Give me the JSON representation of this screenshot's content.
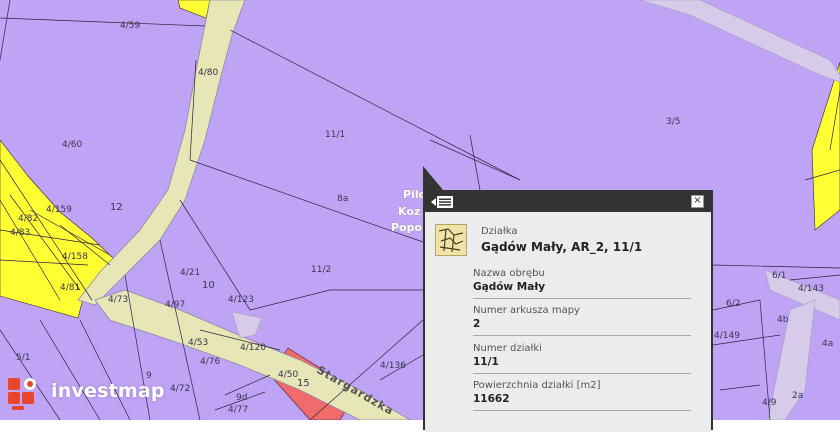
{
  "map": {
    "colors": {
      "background": "#bfa3f4",
      "road": "#e6e6b6",
      "yellow": "#ffff33",
      "red": "#f26b6b",
      "line": "#2e2440"
    },
    "parcel_labels": [
      "4/59",
      "4/80",
      "4/60",
      "11/1",
      "3/5",
      "8a",
      "12",
      "4/82",
      "4/159",
      "4/83",
      "4/158",
      "4/81",
      "4/21",
      "10",
      "11/2",
      "4/73",
      "4/97",
      "4/123",
      "4/53",
      "4/120",
      "4/76",
      "4/50",
      "15",
      "9",
      "4/72",
      "9d",
      "4/77",
      "5/1",
      "4/136",
      "6/1",
      "4/143",
      "6/2",
      "4/149",
      "4b",
      "4a",
      "2a",
      "4/9"
    ],
    "place_label_lines": [
      "Pilo",
      "Koz",
      "Popo"
    ],
    "street_name": "Stargardzka"
  },
  "popup": {
    "category": "Działka",
    "title": "Gądów Mały, AR_2, 11/1",
    "fields": [
      {
        "key": "Nazwa obrębu",
        "value": "Gądów Mały"
      },
      {
        "key": "Numer arkusza mapy",
        "value": "2"
      },
      {
        "key": "Numer działki",
        "value": "11/1"
      },
      {
        "key": "Powierzchnia działki [m2]",
        "value": "11662"
      }
    ],
    "icons": {
      "list": "list-icon",
      "close": "close-icon",
      "thumbnail": "parcel-thumbnail-icon"
    },
    "close_glyph": "×"
  },
  "logo": {
    "text": "investmap",
    "icon": "investmap-logo-icon",
    "color": "#e8452c"
  }
}
